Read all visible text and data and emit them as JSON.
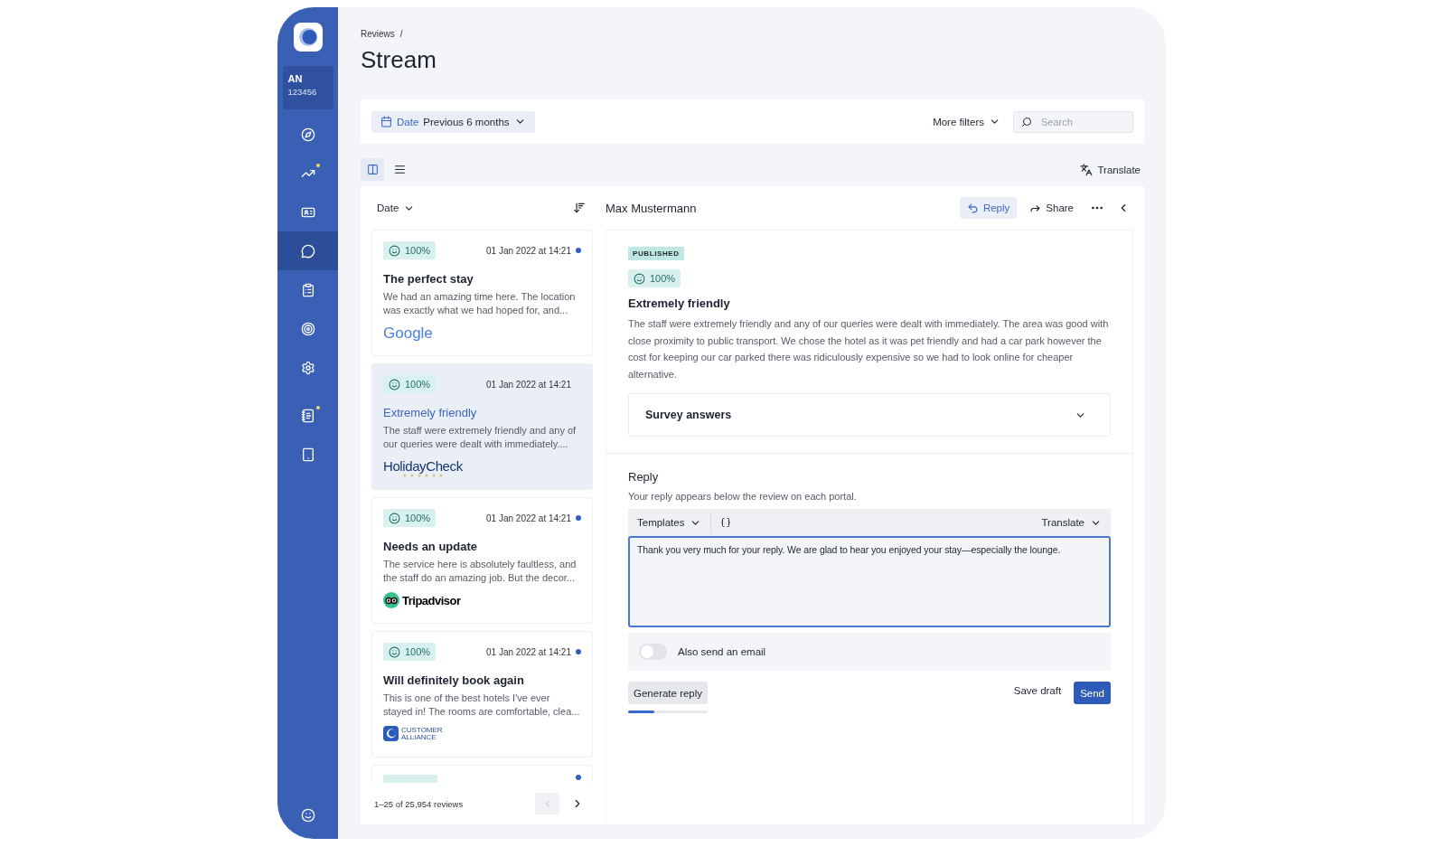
{
  "sidebar": {
    "account": {
      "initials": "AN",
      "number": "123456"
    },
    "items": [
      {
        "selected": false,
        "dot": false
      },
      {
        "selected": false,
        "dot": true
      },
      {
        "selected": false,
        "dot": false
      },
      {
        "selected": true,
        "dot": false
      },
      {
        "selected": false,
        "dot": false
      },
      {
        "selected": false,
        "dot": false
      },
      {
        "selected": false,
        "dot": false
      },
      {
        "selected": false,
        "dot": true
      },
      {
        "selected": false,
        "dot": false
      }
    ]
  },
  "breadcrumb": {
    "items": [
      "Reviews"
    ],
    "separator": "/"
  },
  "title": "Stream",
  "filters": {
    "date": {
      "label": "Date",
      "value": "Previous 6 months"
    },
    "more": "More filters",
    "search": {
      "placeholder": "Search"
    }
  },
  "views": [
    {
      "selected": true
    },
    {
      "selected": false
    }
  ],
  "translate": "Translate",
  "list": {
    "sort": "Date",
    "reviews": [
      {
        "score": "100%",
        "date": "01 Jan 2022 at 14:21",
        "unread": true,
        "selected": false,
        "title": "The perfect stay",
        "excerpt": "We had an amazing time here. The location was exactly what we had hoped for, and...",
        "source": {
          "kind": "google",
          "name": "Google"
        }
      },
      {
        "score": "100%",
        "date": "01 Jan 2022 at 14:21",
        "unread": false,
        "selected": true,
        "title": "Extremely friendly",
        "excerpt": "The staff were extremely friendly and any of our queries were dealt with immediately....",
        "source": {
          "kind": "holidaycheck",
          "name": "HolidayCheck"
        }
      },
      {
        "score": "100%",
        "date": "01 Jan 2022 at 14:21",
        "unread": true,
        "selected": false,
        "title": "Needs an update",
        "excerpt": "The service here is absolutely faultless, and the staff do an amazing job. But the decor...",
        "source": {
          "kind": "tripadvisor",
          "name": "Tripadvisor"
        }
      },
      {
        "score": "100%",
        "date": "01 Jan 2022 at 14:21",
        "unread": true,
        "selected": false,
        "title": "Will definitely book again",
        "excerpt": "This is one of the best hotels I've ever stayed in! The rooms are comfortable, clea...",
        "source": {
          "kind": "customeralliance",
          "name": "CUSTOMER ALLIANCE"
        }
      }
    ],
    "footer": "1–25 of 25,954 reviews",
    "prev_disabled": true
  },
  "detail": {
    "author": "Max Mustermann",
    "actions": [
      {
        "kind": "reply",
        "label": "Reply",
        "selected": true
      },
      {
        "kind": "share",
        "label": "Share",
        "selected": false
      }
    ],
    "status": "PUBLISHED",
    "score": "100%",
    "title": "Extremely friendly",
    "body": "The staff were extremely friendly and any of our queries were dealt with immediately. The area was good with close proximity to public transport. We chose the hotel as it was pet friendly and had a car park however the cost for keeping our car parked there was ridiculously expensive so we had to look online for cheaper alternative.",
    "survey": {
      "label": "Survey answers",
      "expanded": false
    },
    "reply": {
      "heading": "Reply",
      "hint": "Your reply appears below the review on each portal.",
      "templates": "Templates",
      "translate": "Translate",
      "value": "Thank you very much for your reply. We are glad to hear you enjoyed your stay—especially the lounge.",
      "email": {
        "label": "Also send an email",
        "on": false
      },
      "generate": {
        "label": "Generate reply",
        "level": 0.33
      },
      "save": "Save draft",
      "send": "Send"
    }
  }
}
